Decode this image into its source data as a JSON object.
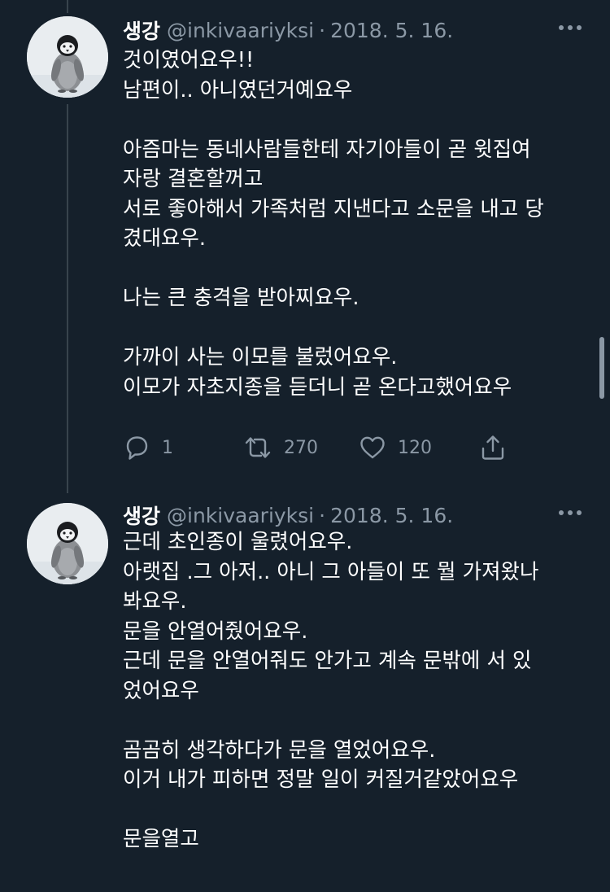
{
  "tweets": [
    {
      "display_name": "생강",
      "handle": "@inkivaariyksi",
      "separator": "·",
      "date": "2018. 5. 16.",
      "lines": [
        "것이였어요우!!",
        "남편이.. 아니였던거예요우",
        "",
        "아즘마는 동네사람들한테 자기아들이 곧 윗집여",
        "자랑 결혼할꺼고",
        "서로 좋아해서 가족처럼 지낸다고 소문을 내고 당",
        "겼대요우.",
        "",
        "나는 큰 충격을 받아찌요우.",
        "",
        "가까이 사는 이모를 불렀어요우.",
        "이모가 자초지종을 듣더니 곧 온다고했어요우"
      ],
      "replies": "1",
      "retweets": "270",
      "likes": "120"
    },
    {
      "display_name": "생강",
      "handle": "@inkivaariyksi",
      "separator": "·",
      "date": "2018. 5. 16.",
      "lines": [
        "근데  초인종이 울렸어요우.",
        "아랫집 .그 아저.. 아니 그 아들이 또 뭘 가져왔나",
        "봐요우.",
        "문을 안열어줬어요우.",
        "근데 문을 안열어줘도 안가고 계속 문밖에 서 있",
        "었어요우",
        "",
        "곰곰히 생각하다가 문을 열었어요우.",
        "이거 내가 피하면 정말 일이 커질거같았어요우",
        "",
        "문을열고"
      ]
    }
  ],
  "icons": {
    "more": "more-horizontal-icon",
    "reply": "reply-icon",
    "retweet": "retweet-icon",
    "like": "heart-icon",
    "share": "share-icon"
  },
  "colors": {
    "background": "#15202b",
    "text_primary": "#ffffff",
    "text_secondary": "#8b98a5",
    "thread_line": "#38444d"
  }
}
